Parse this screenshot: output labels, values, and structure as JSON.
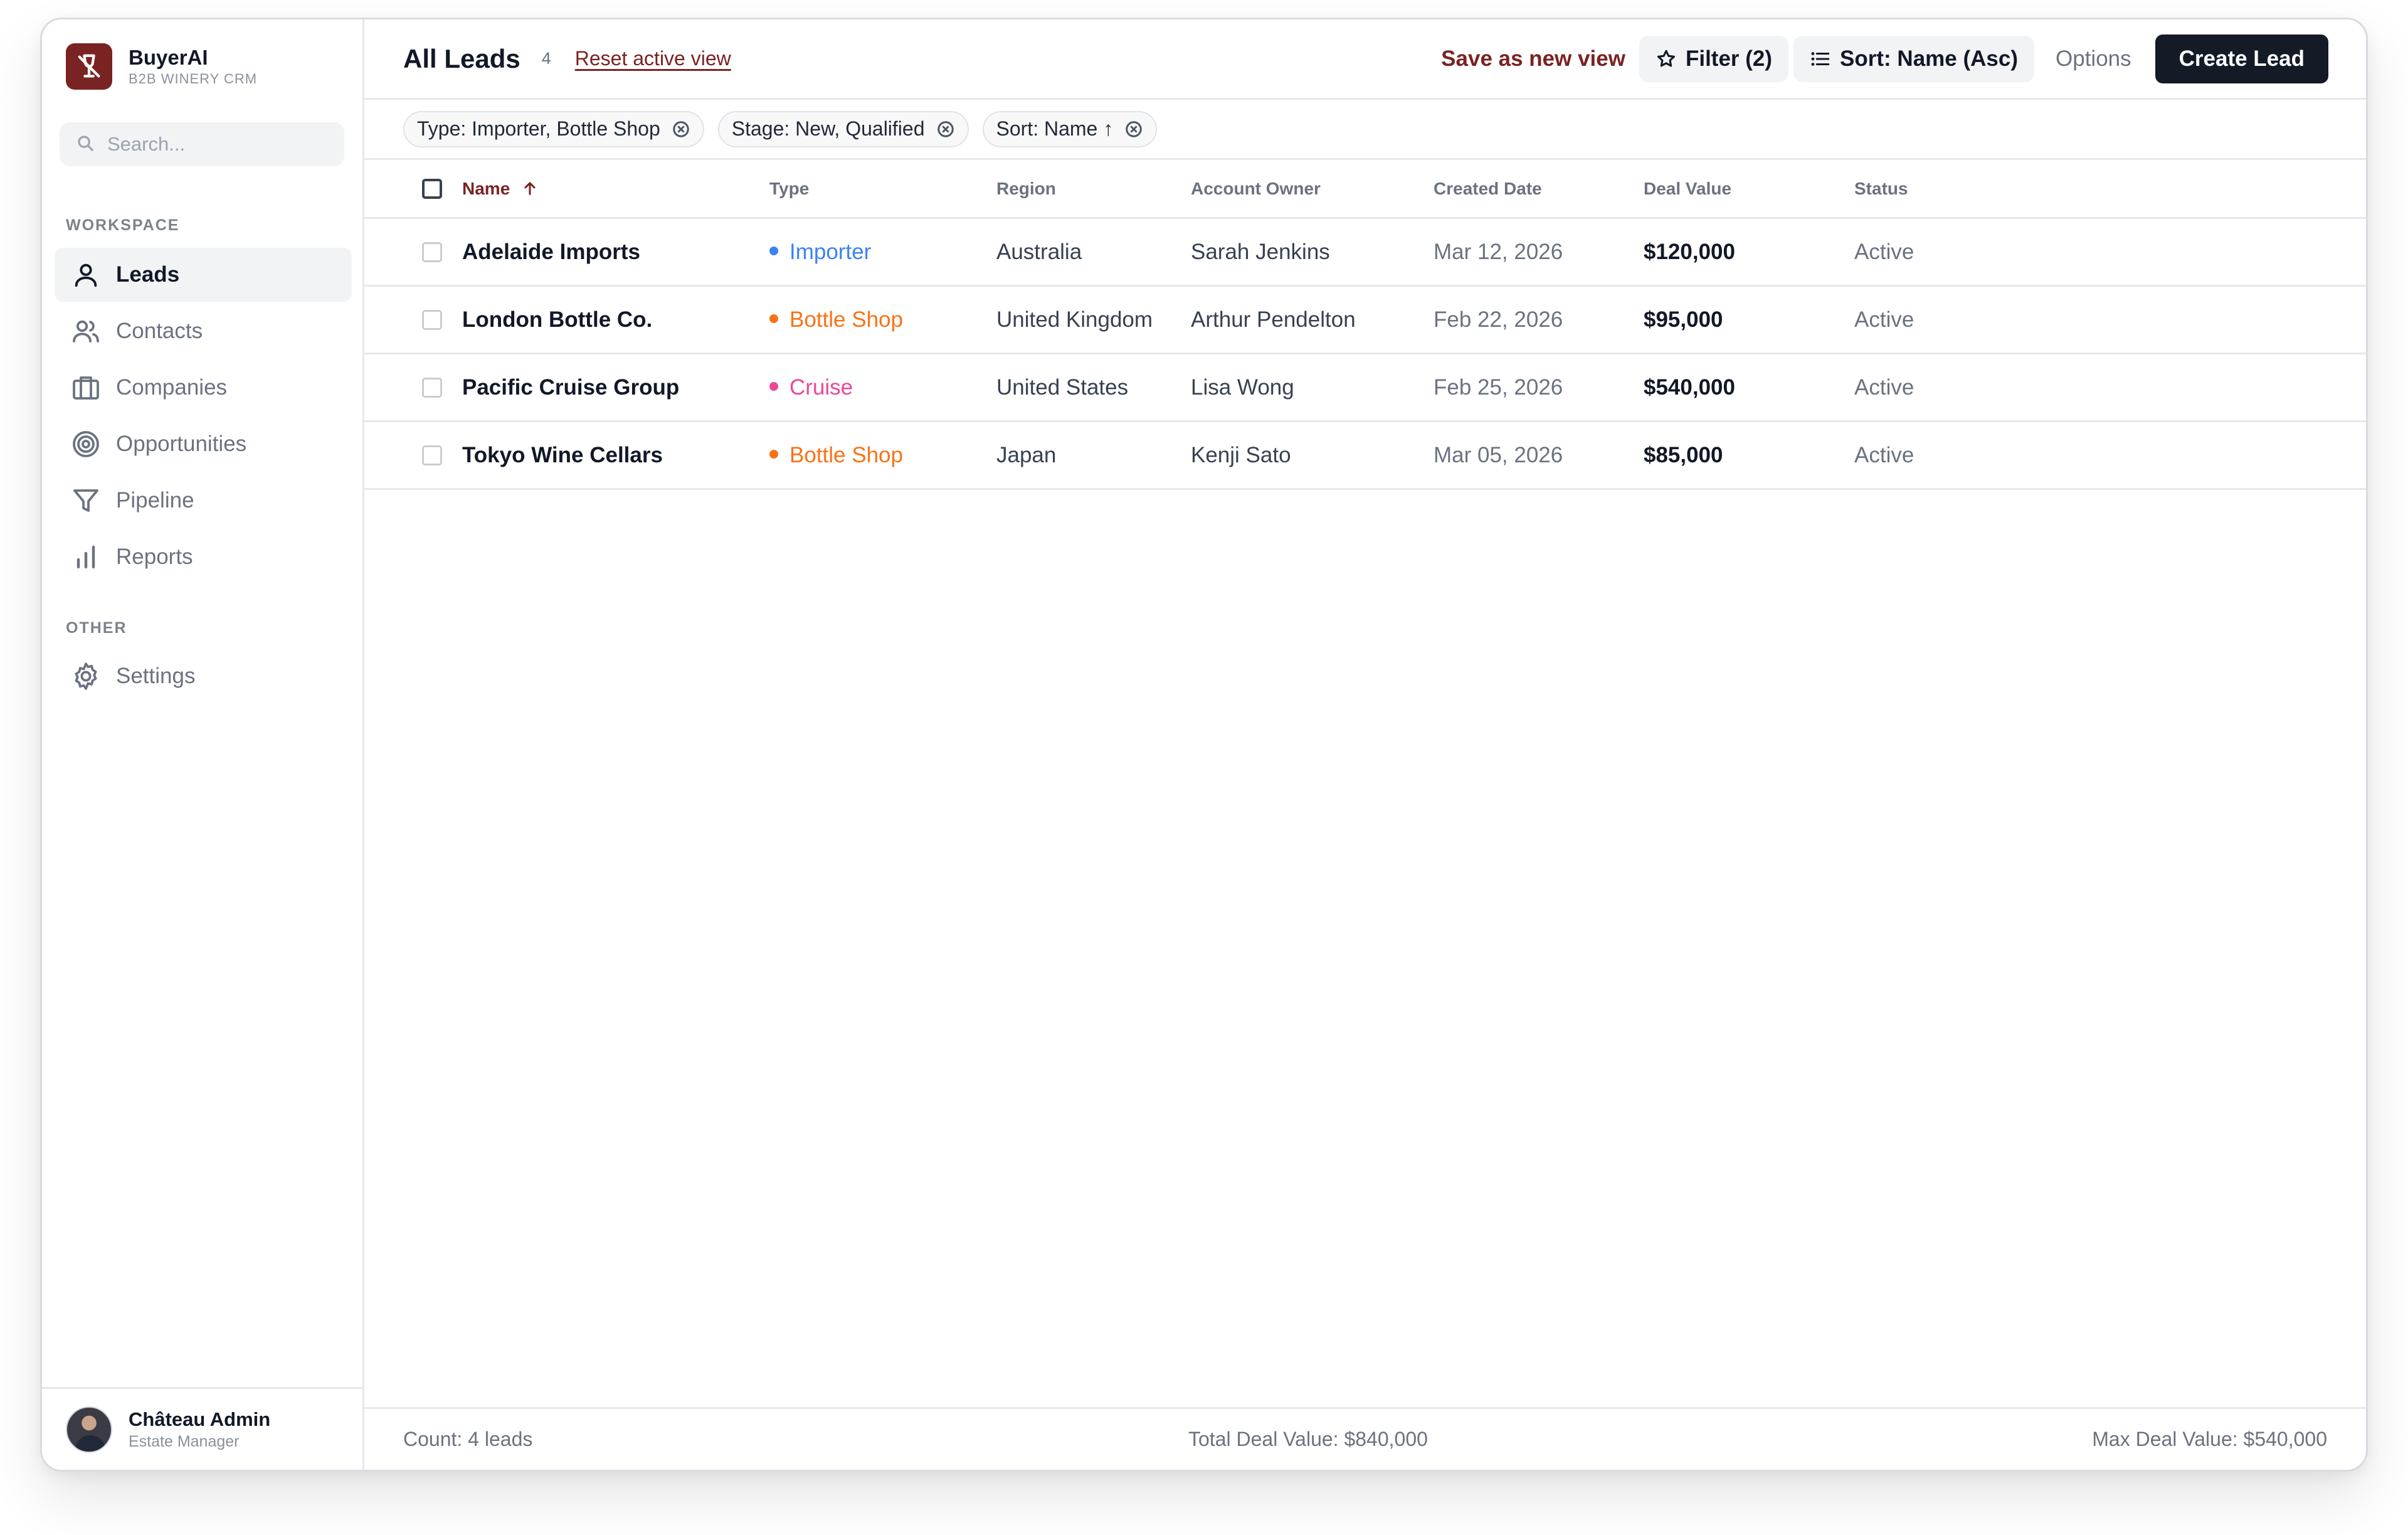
{
  "brand": {
    "name": "BuyerAI",
    "subtitle": "B2B WINERY CRM",
    "logo_color": "#7a2323"
  },
  "search": {
    "placeholder": "Search..."
  },
  "sidebar": {
    "workspace_label": "WORKSPACE",
    "items": [
      {
        "label": "Leads",
        "icon": "user-icon",
        "active": true
      },
      {
        "label": "Contacts",
        "icon": "users-icon"
      },
      {
        "label": "Companies",
        "icon": "briefcase-icon"
      },
      {
        "label": "Opportunities",
        "icon": "target-icon"
      },
      {
        "label": "Pipeline",
        "icon": "funnel-icon"
      },
      {
        "label": "Reports",
        "icon": "bar-chart-icon"
      }
    ],
    "other_label": "OTHER",
    "other_items": [
      {
        "label": "Settings",
        "icon": "gear-icon"
      }
    ]
  },
  "user": {
    "name": "Château Admin",
    "role": "Estate Manager"
  },
  "header": {
    "title": "All Leads",
    "count": "4",
    "reset_label": "Reset active view",
    "save_label": "Save as new view",
    "filter_label": "Filter (2)",
    "sort_label": "Sort: Name (Asc)",
    "options_label": "Options",
    "create_label": "Create Lead"
  },
  "chips": [
    {
      "label": "Type: Importer, Bottle Shop"
    },
    {
      "label": "Stage: New, Qualified"
    },
    {
      "label": "Sort: Name ↑"
    }
  ],
  "table": {
    "columns": [
      "Name",
      "Type",
      "Region",
      "Account Owner",
      "Created Date",
      "Deal Value",
      "Status"
    ],
    "sorted_column": "Name",
    "sort_direction": "asc",
    "rows": [
      {
        "name": "Adelaide Imports",
        "type": "Importer",
        "type_color": "#3b82f6",
        "region": "Australia",
        "owner": "Sarah Jenkins",
        "date": "Mar 12, 2026",
        "value": "$120,000",
        "status": "Active"
      },
      {
        "name": "London Bottle Co.",
        "type": "Bottle Shop",
        "type_color": "#f97316",
        "region": "United Kingdom",
        "owner": "Arthur Pendelton",
        "date": "Feb 22, 2026",
        "value": "$95,000",
        "status": "Active"
      },
      {
        "name": "Pacific Cruise Group",
        "type": "Cruise",
        "type_color": "#ec4899",
        "region": "United States",
        "owner": "Lisa Wong",
        "date": "Feb 25, 2026",
        "value": "$540,000",
        "status": "Active"
      },
      {
        "name": "Tokyo Wine Cellars",
        "type": "Bottle Shop",
        "type_color": "#f97316",
        "region": "Japan",
        "owner": "Kenji Sato",
        "date": "Mar 05, 2026",
        "value": "$85,000",
        "status": "Active"
      }
    ]
  },
  "footer": {
    "count": "Count: 4 leads",
    "total": "Total Deal Value: $840,000",
    "max": "Max Deal Value: $540,000"
  },
  "colors": {
    "accent": "#7a2323",
    "primary_button": "#141a26"
  }
}
